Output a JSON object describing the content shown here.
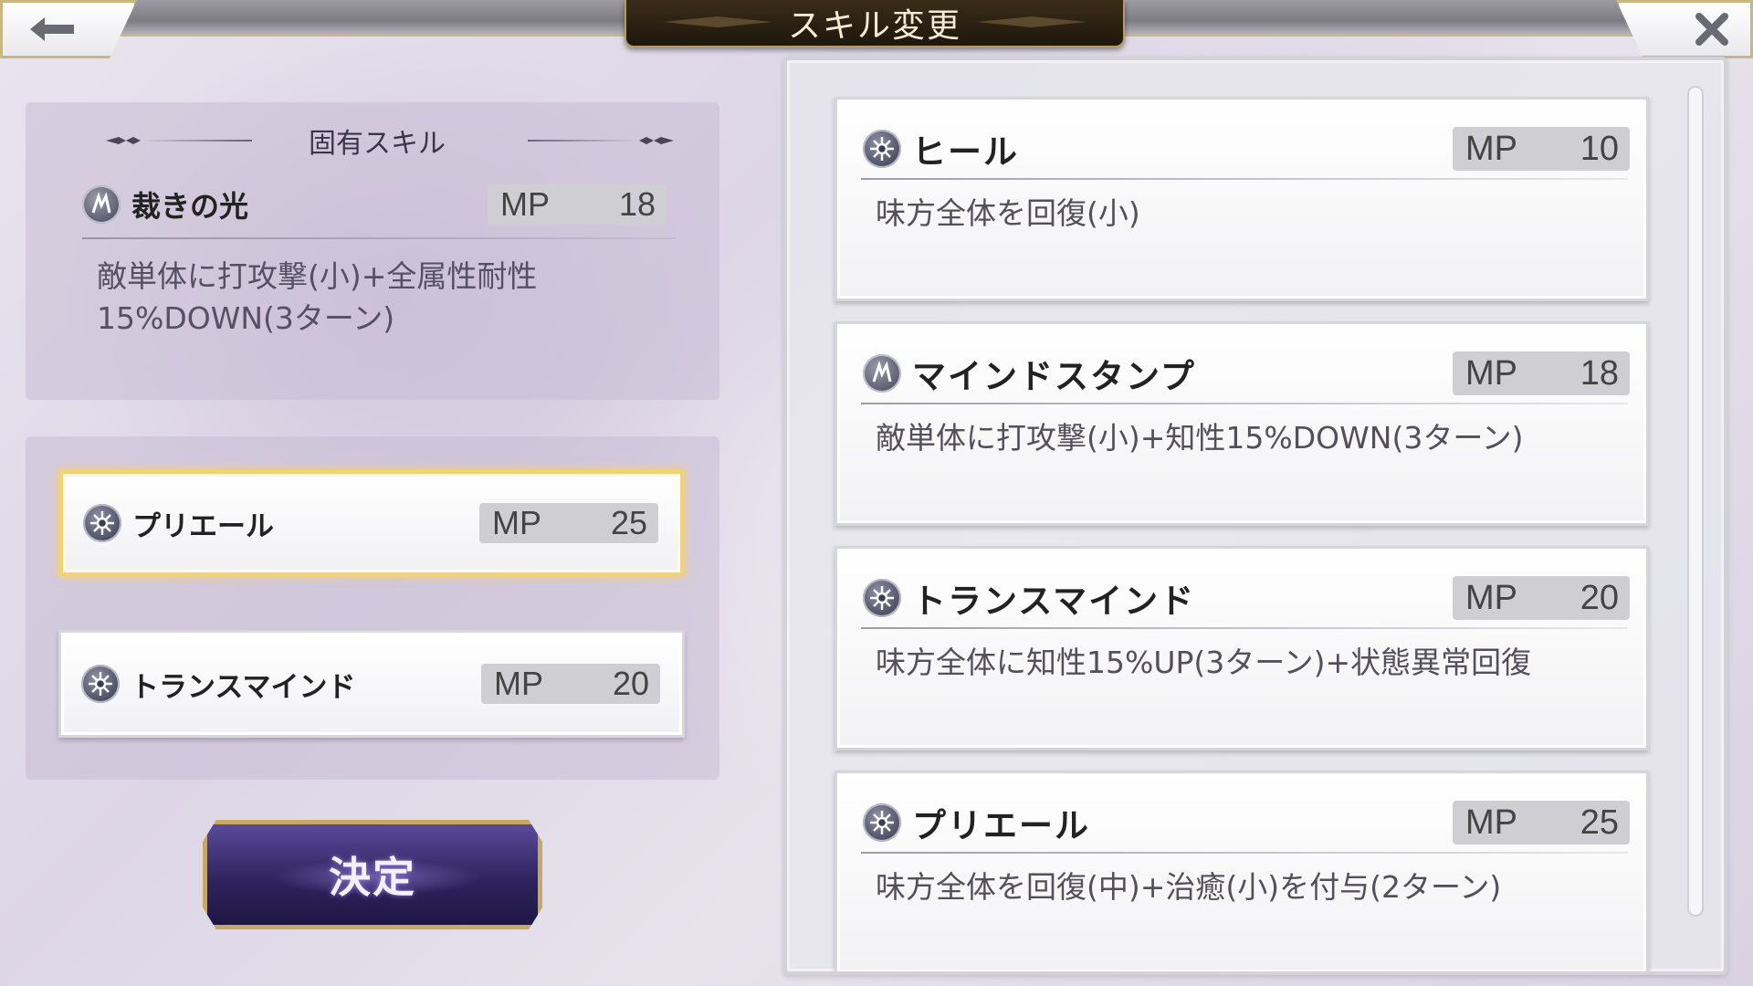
{
  "header": {
    "title": "スキル変更"
  },
  "unique_skill": {
    "section_label": "固有スキル",
    "name": "裁きの光",
    "icon": "mind-icon",
    "mp_label": "MP",
    "mp_value": "18",
    "description": "敵単体に打攻撃(小)+全属性耐性15%DOWN(3ターン)"
  },
  "equipped_skills": [
    {
      "name": "プリエール",
      "icon": "holy-icon",
      "mp_label": "MP",
      "mp_value": "25",
      "selected": true
    },
    {
      "name": "トランスマインド",
      "icon": "holy-icon",
      "mp_label": "MP",
      "mp_value": "20",
      "selected": false
    }
  ],
  "confirm_button": {
    "label": "決定"
  },
  "skill_list": [
    {
      "name": "ヒール",
      "icon": "holy-icon",
      "mp_label": "MP",
      "mp_value": "10",
      "description": "味方全体を回復(小)"
    },
    {
      "name": "マインドスタンプ",
      "icon": "mind-icon",
      "mp_label": "MP",
      "mp_value": "18",
      "description": "敵単体に打攻撃(小)+知性15%DOWN(3ターン)"
    },
    {
      "name": "トランスマインド",
      "icon": "holy-icon",
      "mp_label": "MP",
      "mp_value": "20",
      "description": "味方全体に知性15%UP(3ターン)+状態異常回復"
    },
    {
      "name": "プリエール",
      "icon": "holy-icon",
      "mp_label": "MP",
      "mp_value": "25",
      "description": "味方全体を回復(中)+治癒(小)を付与(2ターン)"
    }
  ],
  "colors": {
    "selected_border": "#f1d27a",
    "frame_gold": "#c9b77e",
    "confirm_purple": "#2f235e"
  }
}
